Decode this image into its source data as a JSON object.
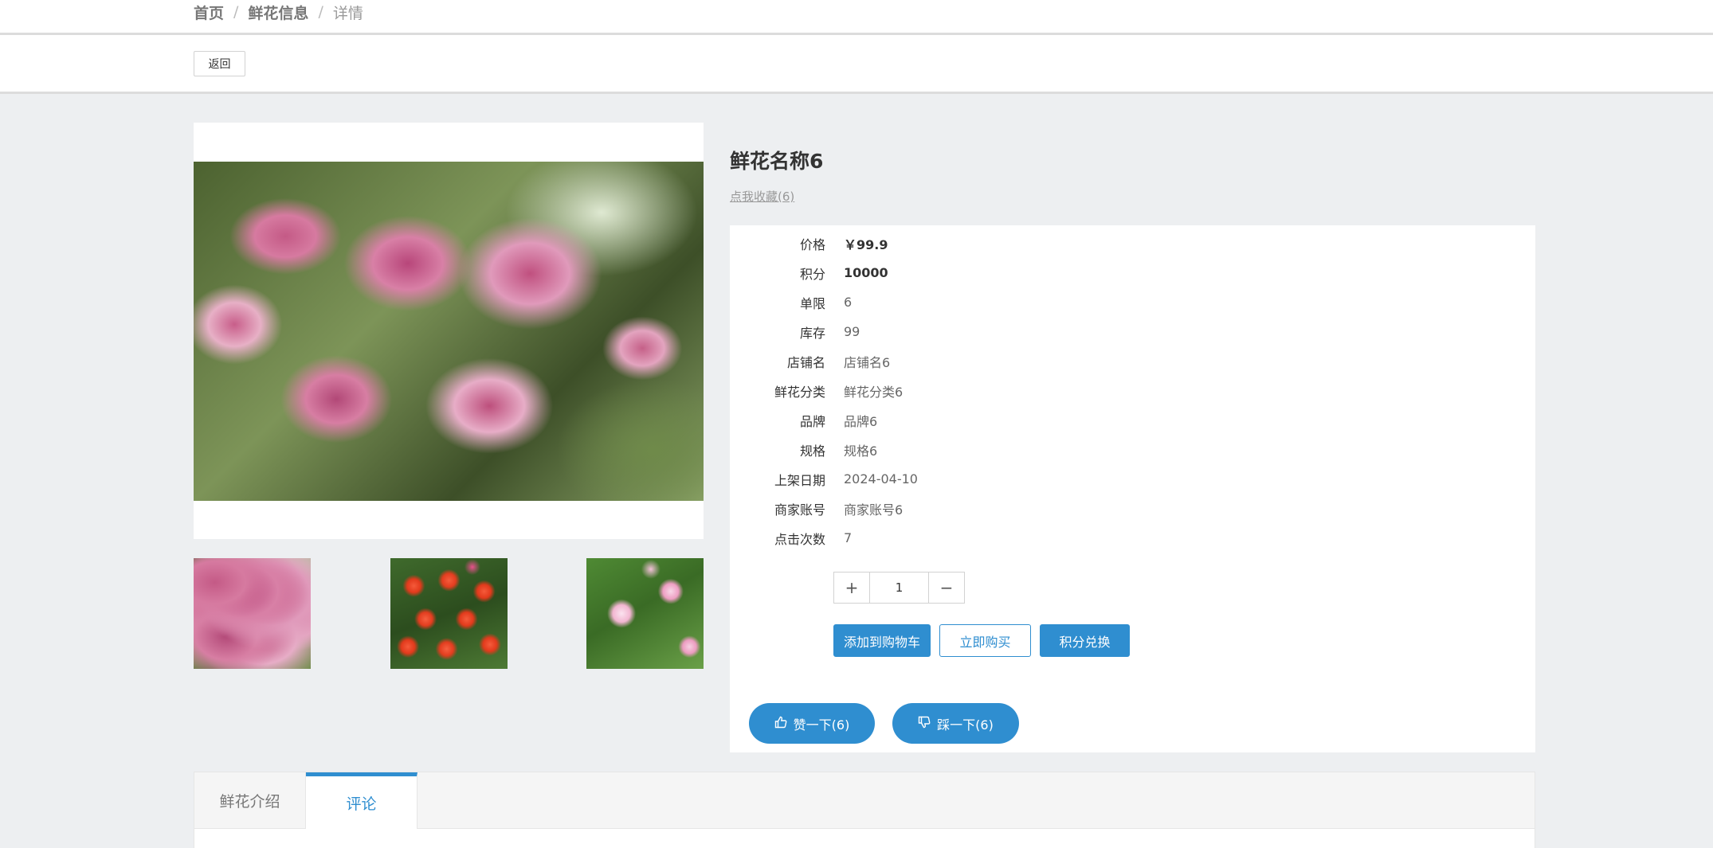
{
  "breadcrumb": {
    "home": "首页",
    "section": "鲜花信息",
    "current": "详情",
    "separator": "/"
  },
  "toolbar": {
    "back_label": "返回"
  },
  "product": {
    "title": "鲜花名称6",
    "favorite_label": "点我收藏(6)",
    "fields": [
      {
        "label": "价格",
        "value": "￥99.9"
      },
      {
        "label": "积分",
        "value": "10000"
      },
      {
        "label": "单限",
        "value": "6"
      },
      {
        "label": "库存",
        "value": "99"
      },
      {
        "label": "店铺名",
        "value": "店铺名6"
      },
      {
        "label": "鲜花分类",
        "value": "鲜花分类6"
      },
      {
        "label": "品牌",
        "value": "品牌6"
      },
      {
        "label": "规格",
        "value": "规格6"
      },
      {
        "label": "上架日期",
        "value": "2024-04-10"
      },
      {
        "label": "商家账号",
        "value": "商家账号6"
      },
      {
        "label": "点击次数",
        "value": "7"
      }
    ]
  },
  "quantity": {
    "value": "1",
    "plus": "+",
    "minus": "−"
  },
  "actions": {
    "add_to_cart": "添加到购物车",
    "buy_now": "立即购买",
    "redeem_points": "积分兑换"
  },
  "votes": {
    "like": "赞一下(6)",
    "dislike": "踩一下(6)"
  },
  "tabs": [
    {
      "label": "鲜花介绍"
    },
    {
      "label": "评论"
    }
  ],
  "colors": {
    "accent": "#2f8ed0",
    "page_bg": "#edeff1"
  },
  "icons": {
    "like": "thumbs-up-icon",
    "dislike": "thumbs-down-icon"
  }
}
